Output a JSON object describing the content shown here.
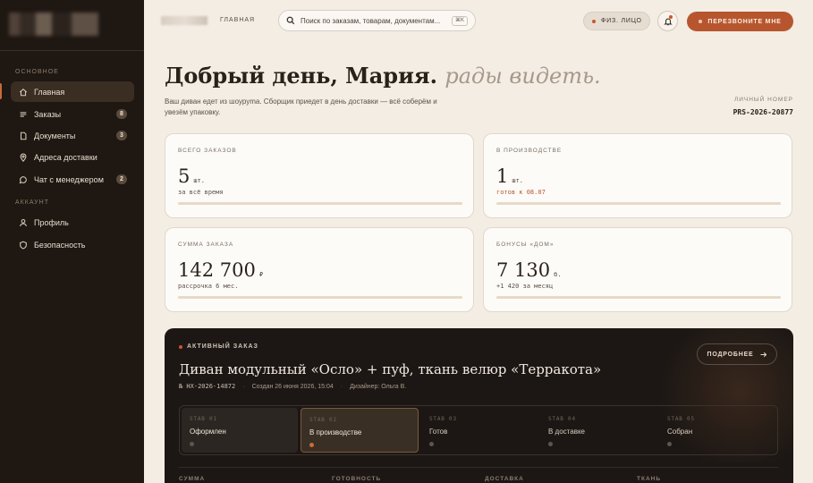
{
  "sidebar": {
    "section_main": "ОСНОВНОЕ",
    "section_account": "АККАУНТ",
    "items": [
      {
        "label": "Главная",
        "icon": "home-icon",
        "badge": ""
      },
      {
        "label": "Заказы",
        "icon": "list-icon",
        "badge": "8"
      },
      {
        "label": "Документы",
        "icon": "document-icon",
        "badge": "3"
      },
      {
        "label": "Адреса доставки",
        "icon": "location-pin-icon",
        "badge": ""
      },
      {
        "label": "Чат с менеджером",
        "icon": "chat-icon",
        "badge": "2"
      },
      {
        "label": "Профиль",
        "icon": "user-icon",
        "badge": ""
      },
      {
        "label": "Безопасность",
        "icon": "shield-icon",
        "badge": ""
      }
    ]
  },
  "topbar": {
    "breadcrumb": "ГЛАВНАЯ",
    "search_placeholder": "Поиск по заказам, товарам, документам...",
    "search_shortcut": "⌘K",
    "person_type": "ФИЗ. ЛИЦО",
    "callback": "ПЕРЕЗВОНИТЕ МНЕ"
  },
  "greeting": {
    "main": "Добрый день, Мария.",
    "accent": "рады видеть.",
    "subtext": "Ваш диван едет из шоуруma. Сборщик приедет в день доставки — всё соберём и увезём упаковку.",
    "account_label": "ЛИЧНЫЙ НОМЕР",
    "account_value": "PRS-2026-20877"
  },
  "cards": [
    {
      "label": "ВСЕГО ЗАКАЗОВ",
      "value": "5",
      "unit": "шт.",
      "sub": "за всё время",
      "progress": 1.0
    },
    {
      "label": "В ПРОИЗВОДСТВЕ",
      "value": "1",
      "unit": "шт.",
      "sub": "готов к 08.07",
      "progress": 1.0
    },
    {
      "label": "СУММА ЗАКАЗА",
      "value": "142 700",
      "unit": "₽",
      "sub": "рассрочка 6 мес.",
      "progress": 1.0
    },
    {
      "label": "БОНУСЫ «ДОМ»",
      "value": "7 130",
      "unit": "б.",
      "sub": "+1 420 за месяц",
      "progress": 1.0
    }
  ],
  "order": {
    "tag": "АКТИВНЫЙ ЗАКАЗ",
    "title": "Диван модульный «Осло» + пуф, ткань велюр «Терракота»",
    "number": "№ НХ-2026-14872",
    "created": "Создан 26 июня 2026, 15:04",
    "designer": "Дизайнер: Ольга В.",
    "more_label": "ПОДРОБНЕЕ",
    "stages": [
      {
        "code": "STAB 01",
        "name": "Оформлен",
        "state": "done"
      },
      {
        "code": "STAB 02",
        "name": "В производстве",
        "state": "current"
      },
      {
        "code": "STAB 03",
        "name": "Готов",
        "state": "pending"
      },
      {
        "code": "STAB 04",
        "name": "В доставке",
        "state": "pending"
      },
      {
        "code": "STAB 05",
        "name": "Собран",
        "state": "pending"
      }
    ],
    "footer_labels": [
      "СУММА",
      "ГОТОВНОСТЬ",
      "ДОСТАВКА",
      "ТКАНЬ"
    ]
  },
  "colors": {
    "accent": "#b7562e",
    "sidebar": "#1e1712",
    "background": "#f3ede4",
    "panel": "#1c1714"
  }
}
